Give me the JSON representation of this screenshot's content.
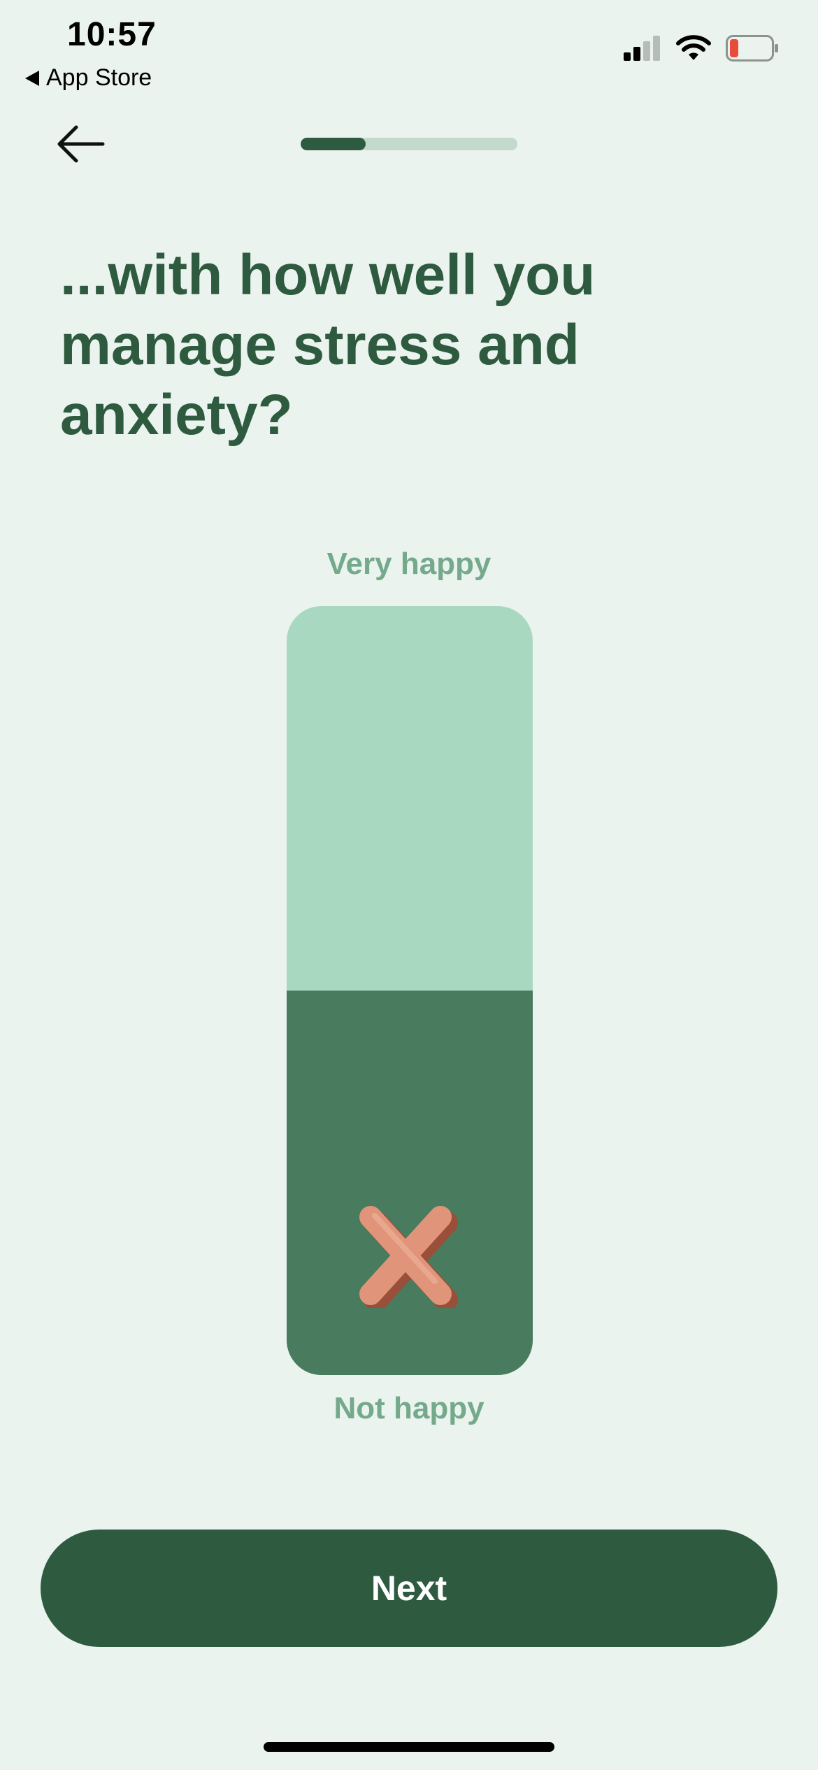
{
  "status_bar": {
    "time": "10:57",
    "back_app": "App Store",
    "battery_color": "#e94b3c"
  },
  "header": {
    "back_icon": "arrow-left-icon",
    "progress": 0.3
  },
  "question": {
    "title": "...with how well you manage stress and anxiety?"
  },
  "scale": {
    "top_label": "Very happy",
    "bottom_label": "Not happy",
    "value": 0.5,
    "icon": "x-mark-icon",
    "colors": {
      "track": "#a8d9c0",
      "fill": "#497b5e",
      "label": "#75a98b",
      "icon": "#e0957a"
    }
  },
  "footer": {
    "next_label": "Next"
  },
  "colors": {
    "background": "#eaf3ed",
    "primary": "#2e5a3f",
    "progress_track": "#c3d9cc"
  }
}
